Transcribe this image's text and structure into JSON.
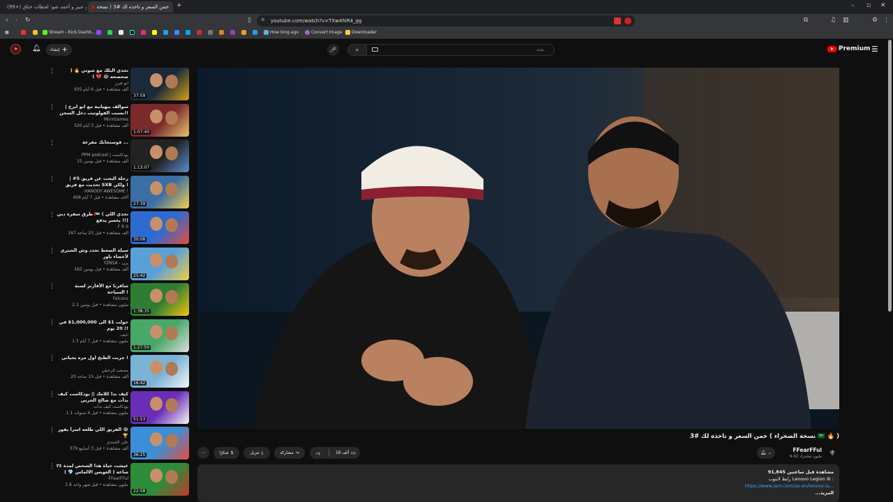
{
  "browser": {
    "tabs": [
      {
        "title": "(99+) أبو عبير و أحمد شو: لحظات خناق"
      },
      {
        "title": "خمن السعر و تاخذه لك #3 ( نسخة"
      }
    ],
    "url": "youtube.com/watch?v=TXw4hiR4_gg",
    "bookmarks": [
      "Stream - Kick Dashb...",
      "How long ago",
      "Convert Image",
      "Downloader"
    ]
  },
  "header": {
    "logo_text": "Premium",
    "logo_sup": "SA",
    "search_placeholder": "بحث",
    "create_label": "إنشاء"
  },
  "video": {
    "title": "خمن السعر و تاخذه لك #3 ( نسخة الصحراء 🇸🇦 🔥 )",
    "channel": "FFearFFul",
    "subscribers": "9.42 مليون مشترك",
    "likes": "16 ألف",
    "share_label": "مشاركة",
    "download_label": "تنزيل",
    "thanks_label": "شكرًا",
    "description": {
      "views": "91,845 مشاهدة قبل ساعتين",
      "line1": "رابط لابتوب Lenovo Legion 9i :",
      "link": "https://www.jarir.com/sa-en/lenovo-la...",
      "more": "...المزيد"
    }
  },
  "recommendations": [
    {
      "title": "تحدي البلك مع شوتي 🔥 ( صحصحه 😂 💔 )",
      "channel": "ابو فيرز",
      "meta": "935 ألف مشاهدة • قبل 6 أيام",
      "duration": "37:59"
    },
    {
      "title": "سوالف ببهيانية مع ابو ابرخ | بسبب الفولوتيب دخل السجن!! 😂🔥",
      "channel": "MirrrGames",
      "meta": "520 ألف مشاهدة • قبل 3 أيام",
      "duration": "1:07:40"
    },
    {
      "title": "قوسنجانك مفرعة ...",
      "channel": "PPM podcast | بودكاست",
      "meta": "15 ألف مشاهدة • قبل يومين",
      "duration": "1:13:07"
    },
    {
      "title": "رحلة البحث عن فريق 5# | تحديث مع فريق SXB ولكن !",
      "channel": "HANODY AWESOME !",
      "meta": "408 آلاف مشاهدة • قبل 7 أيام",
      "duration": "27:39"
    },
    {
      "title": "طرق سفرة دبي 🇦🇪 ( تحدي اللي يخسر يدفع !!)",
      "channel": "F R S",
      "meta": "167 ألف مشاهدة • قبل 23 ساعة",
      "duration": "30:08"
    },
    {
      "title": "سيلة الضغط تحدد وش الشتري لأعضاء باور",
      "channel": "YZNSA - يزن",
      "meta": "162 ألف مشاهدة • قبل يومين",
      "duration": "25:42"
    },
    {
      "title": "سافرنا مع الأقارنز لسنة السياحة !",
      "channel": "Falcons",
      "meta": "2.1 مليون مشاهدة • قبل يومين",
      "duration": "1:38:35"
    },
    {
      "title": "حولت 1$ الى 1,000,000$ في 20 يوم !!",
      "channel": "نايف",
      "meta": "1.3 مليون مشاهدة • قبل 7 أيام",
      "duration": "1:27:50"
    },
    {
      "title": "جربت الطبخ اول مره بحياتي !",
      "channel": "مصعب الرحيلي",
      "meta": "20 ألف مشاهدة • قبل 15 ساعة",
      "duration": "16:42"
    },
    {
      "title": "كيف بدا كلامك || بودكاست كيف بدأت مع صالح الحربي",
      "channel": "بودكاست كيف بدأت",
      "meta": "1.1 مليون مشاهدة • قبل 4 سنوات",
      "duration": "51:53"
    },
    {
      "title": "الفريق اللي طلعه اسرأ يفوز 😂 🏆",
      "channel": "علي الحمدي",
      "meta": "379 ألف مشاهدة • قبل 3 أسابيع",
      "duration": "36:25"
    },
    {
      "title": "عيشت حياة هذا الشخص لمدة ٢٤ ساعه ( العوبس الالماس 💎 )",
      "channel": "FFearFFul",
      "meta": "1.6 مليون مشاهدة • قبل شهر واحد",
      "duration": "22:58"
    }
  ]
}
